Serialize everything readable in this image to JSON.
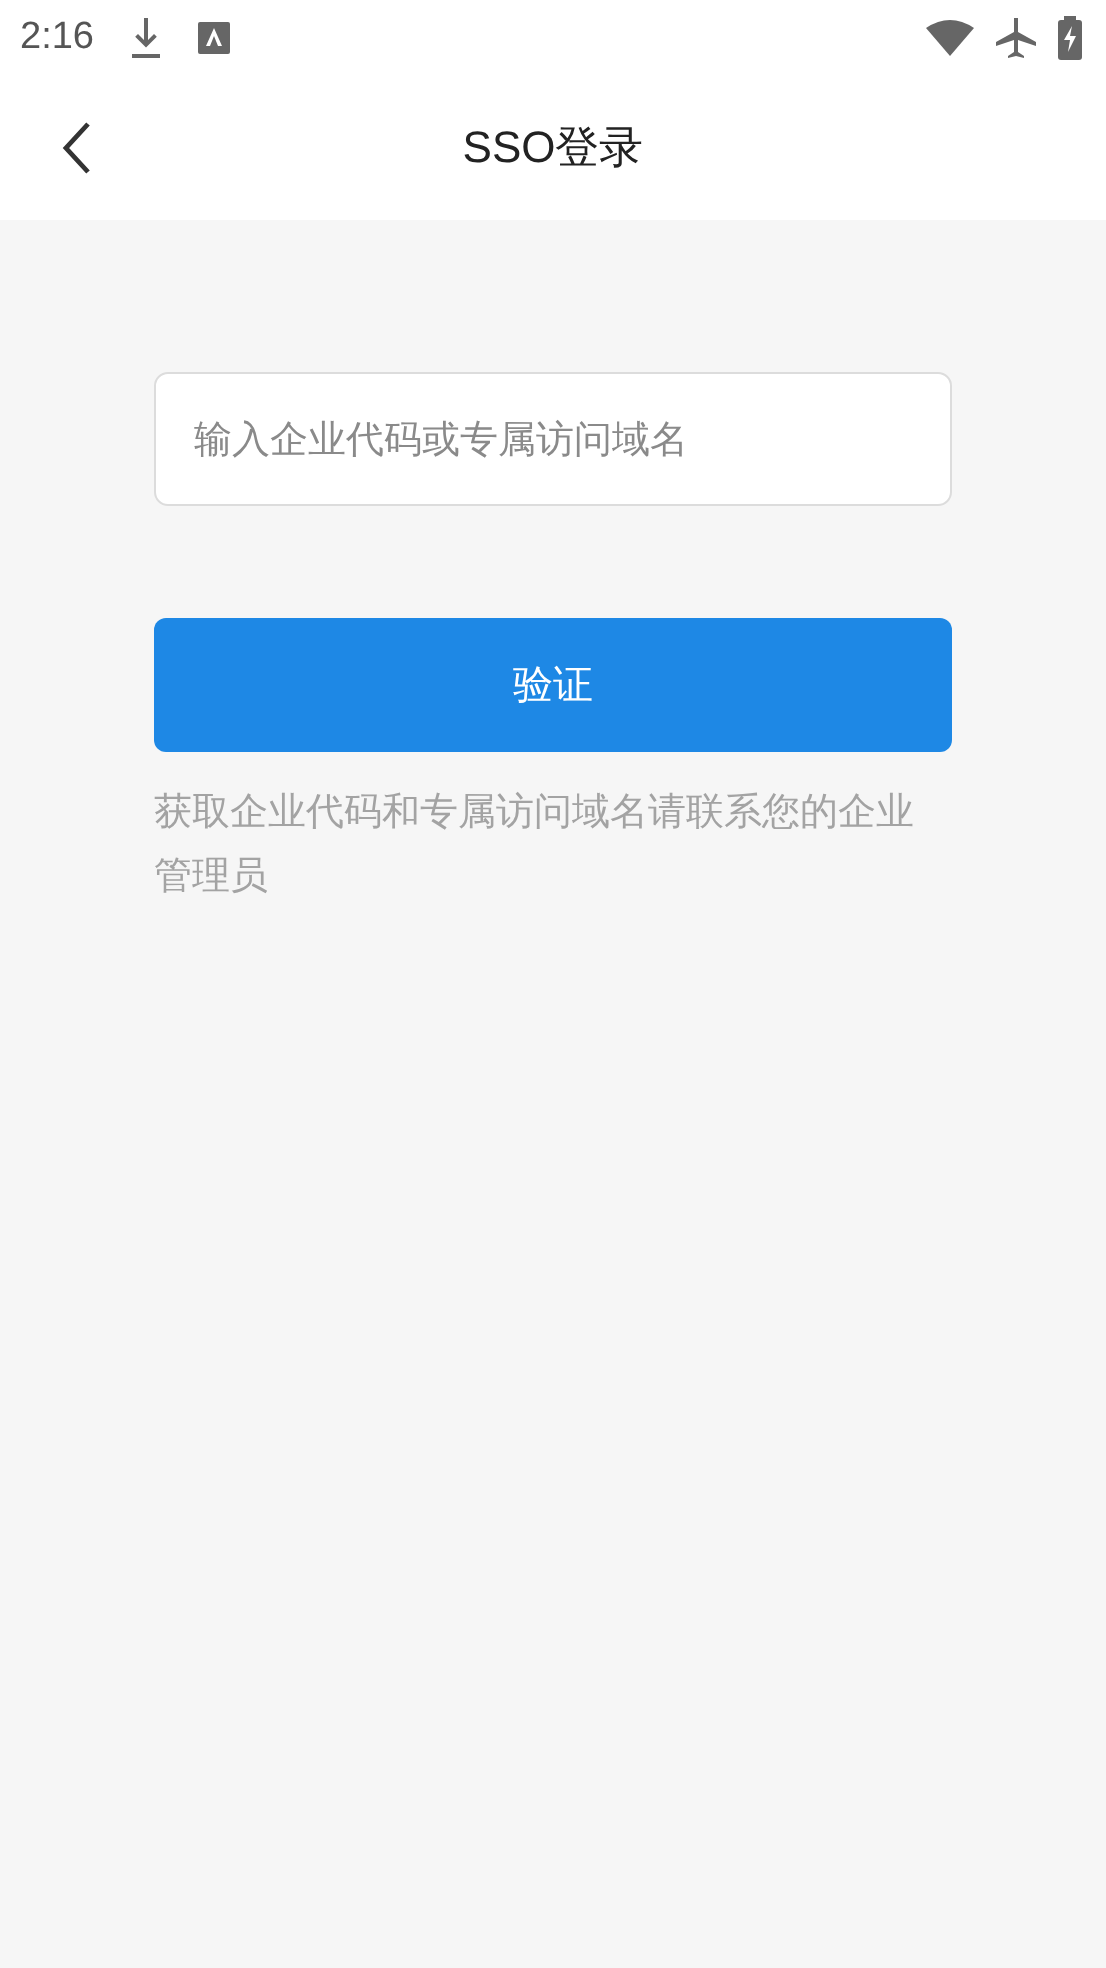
{
  "status_bar": {
    "time": "2:16"
  },
  "header": {
    "title": "SSO登录"
  },
  "form": {
    "input": {
      "placeholder": "输入企业代码或专属访问域名"
    },
    "button": "验证",
    "hint": "获取企业代码和专属访问域名请联系您的企业管理员"
  }
}
